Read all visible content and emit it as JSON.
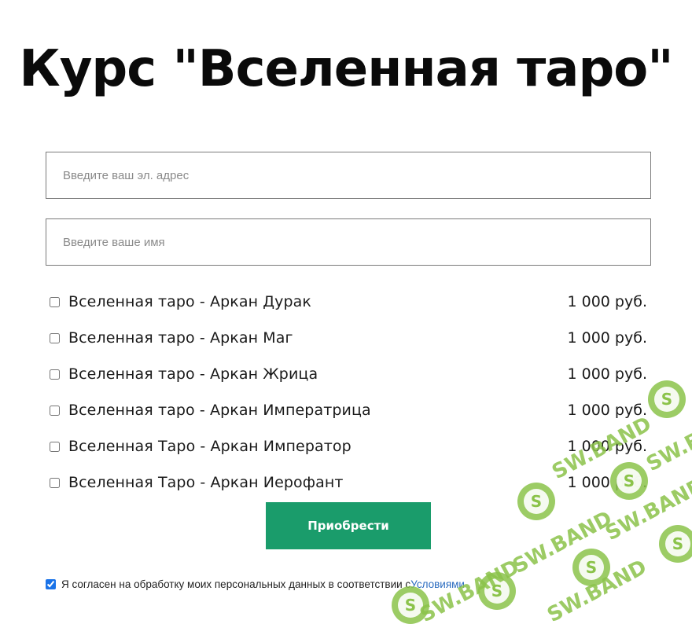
{
  "page": {
    "title": "Курс \"Вселенная таро\""
  },
  "form": {
    "email_placeholder": "Введите ваш эл. адрес",
    "email_value": "",
    "name_placeholder": "Введите ваше имя",
    "name_value": ""
  },
  "products": [
    {
      "name": "Вселенная таро - Аркан Дурак",
      "price": "1 000 руб.",
      "checked": false
    },
    {
      "name": "Вселенная таро - Аркан Маг",
      "price": "1 000 руб.",
      "checked": false
    },
    {
      "name": "Вселенная таро - Аркан Жрица",
      "price": "1 000 руб.",
      "checked": false
    },
    {
      "name": "Вселенная таро - Аркан Императрица",
      "price": "1 000 руб.",
      "checked": false
    },
    {
      "name": "Вселенная Таро - Аркан Император",
      "price": "1 000 руб.",
      "checked": false
    },
    {
      "name": "Вселенная Таро - Аркан Иерофант",
      "price": "1 000 руб.",
      "checked": false
    }
  ],
  "buy_button": {
    "label": "Приобрести",
    "color": "#1a9c6b"
  },
  "consent": {
    "checked": true,
    "text": "Я согласен на обработку моих персональных данных в соответствии с ",
    "link_text": "Условиями"
  },
  "watermark": {
    "text": "SW.BAND",
    "logo_letter": "S",
    "color": "#8bc34a"
  }
}
